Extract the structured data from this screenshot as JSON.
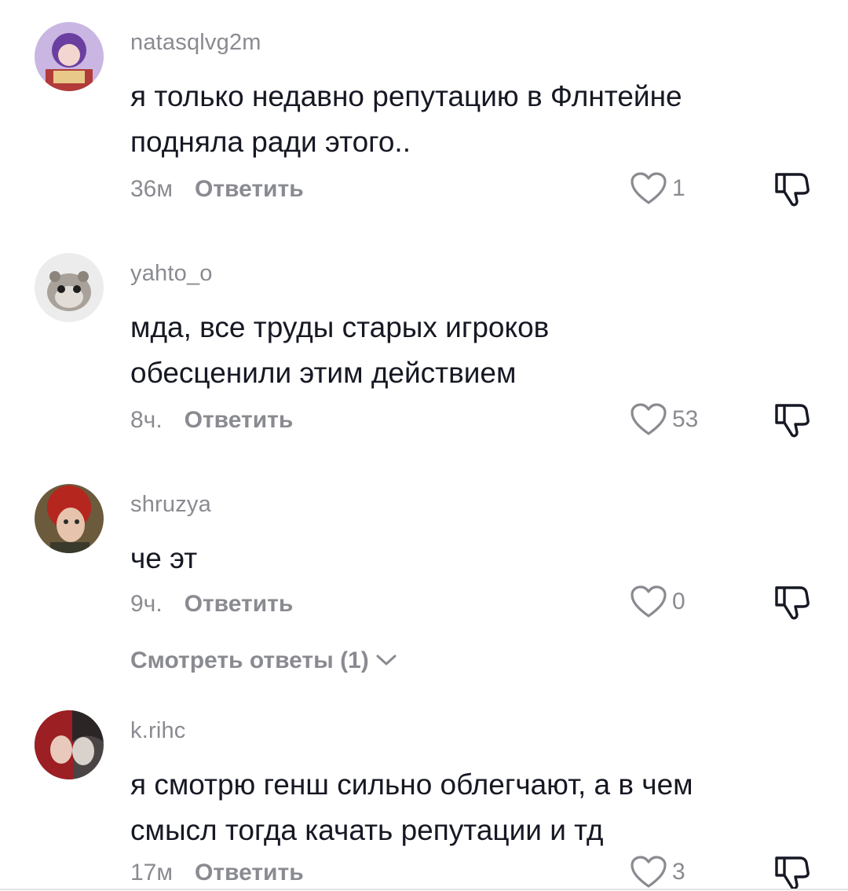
{
  "comments": [
    {
      "username": "natasqlvg2m",
      "text": "я только недавно репутацию в Флнтейне подняла ради этого..",
      "time": "36м",
      "reply_label": "Ответить",
      "likes": "1"
    },
    {
      "username": "yahto_o",
      "text": "мда, все труды старых игроков обесценили этим действием",
      "time": "8ч.",
      "reply_label": "Ответить",
      "likes": "53"
    },
    {
      "username": "shruzya",
      "text": "че эт",
      "time": "9ч.",
      "reply_label": "Ответить",
      "likes": "0",
      "view_replies_label": "Смотреть ответы (1)"
    },
    {
      "username": "k.rihc",
      "text": "я смотрю генш сильно облегчают, а в чем смысл тогда качать репутации и тд",
      "time": "17м",
      "reply_label": "Ответить",
      "likes": "3"
    }
  ],
  "colors": {
    "primary_text": "#161823",
    "secondary_text": "#8a8b91",
    "background": "#ffffff"
  },
  "icons": {
    "like": "heart-outline-icon",
    "dislike": "thumbs-down-outline-icon",
    "expand": "chevron-down-icon"
  }
}
